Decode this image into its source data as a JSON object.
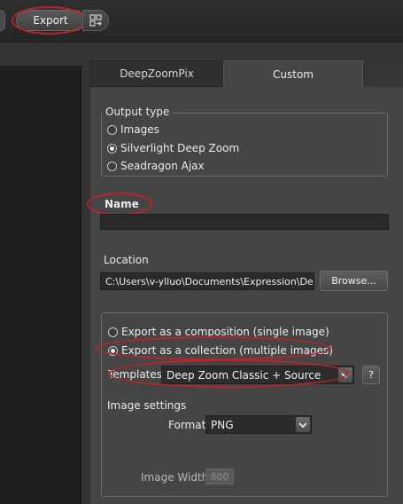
{
  "toolbar": {
    "export_label": "Export",
    "icon": "export-options-icon"
  },
  "tabs": [
    {
      "label": "DeepZoomPix",
      "active": false
    },
    {
      "label": "Custom",
      "active": true
    }
  ],
  "output_type": {
    "legend": "Output type",
    "options": [
      {
        "label": "Images",
        "selected": false
      },
      {
        "label": "Silverlight Deep Zoom",
        "selected": true
      },
      {
        "label": "Seadragon Ajax",
        "selected": false
      }
    ]
  },
  "name": {
    "label": "Name",
    "value": ""
  },
  "location": {
    "label": "Location",
    "value": "C:\\Users\\v-ylluo\\Documents\\Expression\\Deep Z",
    "browse_label": "Browse..."
  },
  "export_mode": {
    "options": [
      {
        "label": "Export as a composition (single image)",
        "selected": false
      },
      {
        "label": "Export as a collection (multiple images)",
        "selected": true
      }
    ]
  },
  "templates": {
    "label": "Templates",
    "selected": "Deep Zoom Classic + Source",
    "help_label": "?"
  },
  "image_settings": {
    "label": "Image settings",
    "format_label": "Format",
    "format_value": "PNG",
    "width_label": "Image Width",
    "width_value": "800"
  },
  "colors": {
    "annotation_ring": "#b8242a",
    "panel_bg": "#454545",
    "toolbar_bg": "#2a2a2a"
  }
}
